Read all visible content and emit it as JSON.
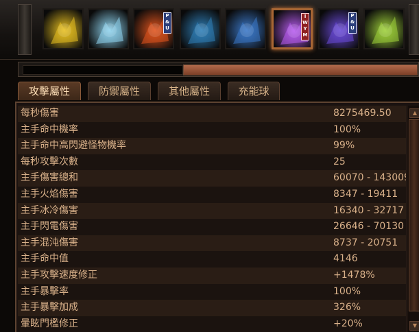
{
  "skills": [
    {
      "name": "skill-lightning-figure",
      "tag": "",
      "color": "#e8c020"
    },
    {
      "name": "skill-ice-figure",
      "tag": "",
      "color": "#8fd4ef"
    },
    {
      "name": "skill-fire-dance",
      "tag": "P\n&\nU",
      "color": "#e0541e"
    },
    {
      "name": "skill-frost-orb",
      "tag": "",
      "color": "#2f7fb8"
    },
    {
      "name": "skill-blue-hand",
      "tag": "",
      "color": "#3b78c8"
    },
    {
      "name": "skill-purple-lightning",
      "tag": "I\nW\nY\nM",
      "color": "#b85cf0",
      "active": true
    },
    {
      "name": "skill-storm-figure",
      "tag": "P\n&\nU",
      "color": "#6a4ad8"
    },
    {
      "name": "skill-green-strike",
      "tag": "",
      "color": "#9fd13a"
    }
  ],
  "progress": {
    "fill_percent": 100
  },
  "tabs": [
    {
      "label": "攻擊屬性",
      "active": true
    },
    {
      "label": "防禦屬性"
    },
    {
      "label": "其他屬性"
    },
    {
      "label": "充能球"
    }
  ],
  "stats": [
    {
      "label": "每秒傷害",
      "value": "8275469.50"
    },
    {
      "label": "主手命中機率",
      "value": "100%"
    },
    {
      "label": "主手命中高閃避怪物機率",
      "value": "99%"
    },
    {
      "label": "每秒攻擊次數",
      "value": "25"
    },
    {
      "label": "主手傷害總和",
      "value": "60070 - 143009"
    },
    {
      "label": "主手火焰傷害",
      "value": "8347 - 19411"
    },
    {
      "label": "主手冰冷傷害",
      "value": "16340 - 32717"
    },
    {
      "label": "主手閃電傷害",
      "value": "26646 - 70130"
    },
    {
      "label": "主手混沌傷害",
      "value": "8737 - 20751"
    },
    {
      "label": "主手命中值",
      "value": "4146"
    },
    {
      "label": "主手攻擊速度修正",
      "value": "+1478%"
    },
    {
      "label": "主手暴擊率",
      "value": "100%"
    },
    {
      "label": "主手暴擊加成",
      "value": "326%"
    },
    {
      "label": "暈眩門檻修正",
      "value": "+20%"
    }
  ],
  "icons": {
    "scroll_up": "scroll-up-arrow-icon",
    "scroll_down": "scroll-down-arrow-icon"
  }
}
